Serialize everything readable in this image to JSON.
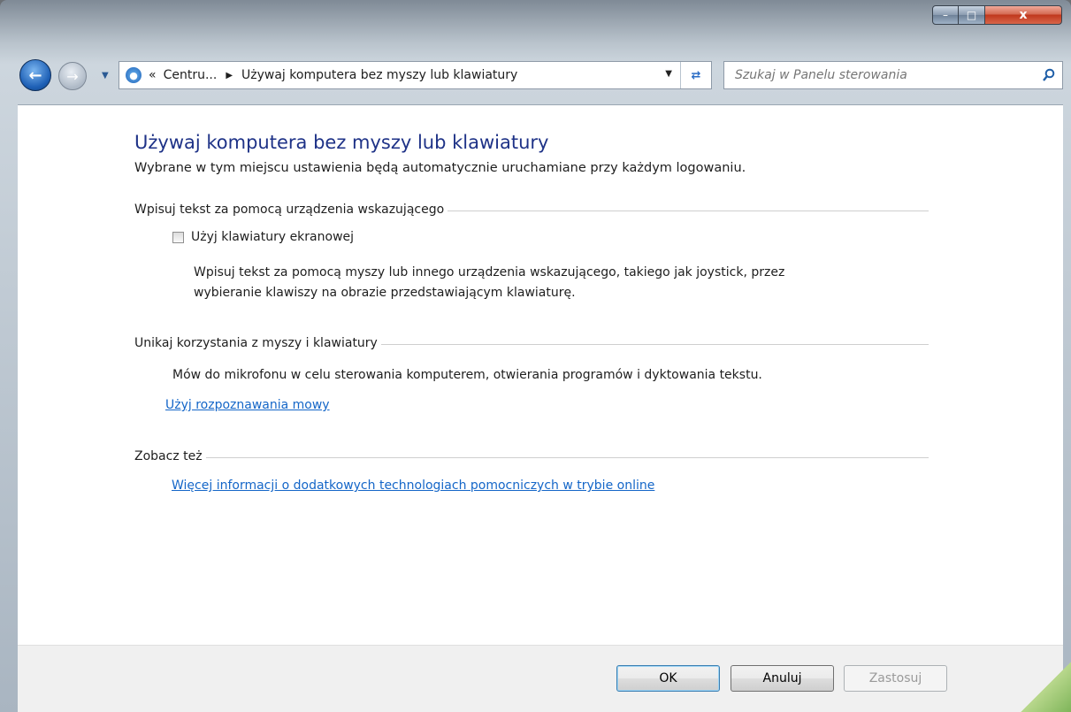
{
  "window": {
    "controls": {
      "minimize": "–",
      "maximize": "□",
      "close": "x"
    }
  },
  "nav": {
    "breadcrumb_prefix": "«",
    "breadcrumb_parent": "Centru...",
    "breadcrumb_separator": "▶",
    "breadcrumb_current": "Używaj komputera bez myszy lub klawiatury",
    "search_placeholder": "Szukaj w Panelu sterowania"
  },
  "page": {
    "title": "Używaj komputera bez myszy lub klawiatury",
    "description": "Wybrane w tym miejscu ustawienia będą automatycznie uruchamiane przy każdym logowaniu.",
    "sections": [
      {
        "heading": "Wpisuj tekst za pomocą urządzenia wskazującego",
        "checkbox_label": "Użyj klawiatury ekranowej",
        "checkbox_checked": false,
        "text_line1": "Wpisuj tekst za pomocą myszy lub innego urządzenia wskazującego, takiego jak joystick, przez",
        "text_line2": "wybieranie klawiszy na obrazie przedstawiającym klawiaturę."
      },
      {
        "heading": "Unikaj korzystania z myszy i klawiatury",
        "text": "Mów do mikrofonu w celu sterowania komputerem, otwierania programów i dyktowania tekstu.",
        "link": "Użyj rozpoznawania mowy"
      },
      {
        "heading": "Zobacz też",
        "link": "Więcej informacji o dodatkowych technologiach pomocniczych w trybie online"
      }
    ]
  },
  "footer": {
    "ok": "OK",
    "cancel": "Anuluj",
    "apply": "Zastosuj"
  },
  "colors": {
    "title": "#1e3287",
    "link": "#1466c8"
  }
}
